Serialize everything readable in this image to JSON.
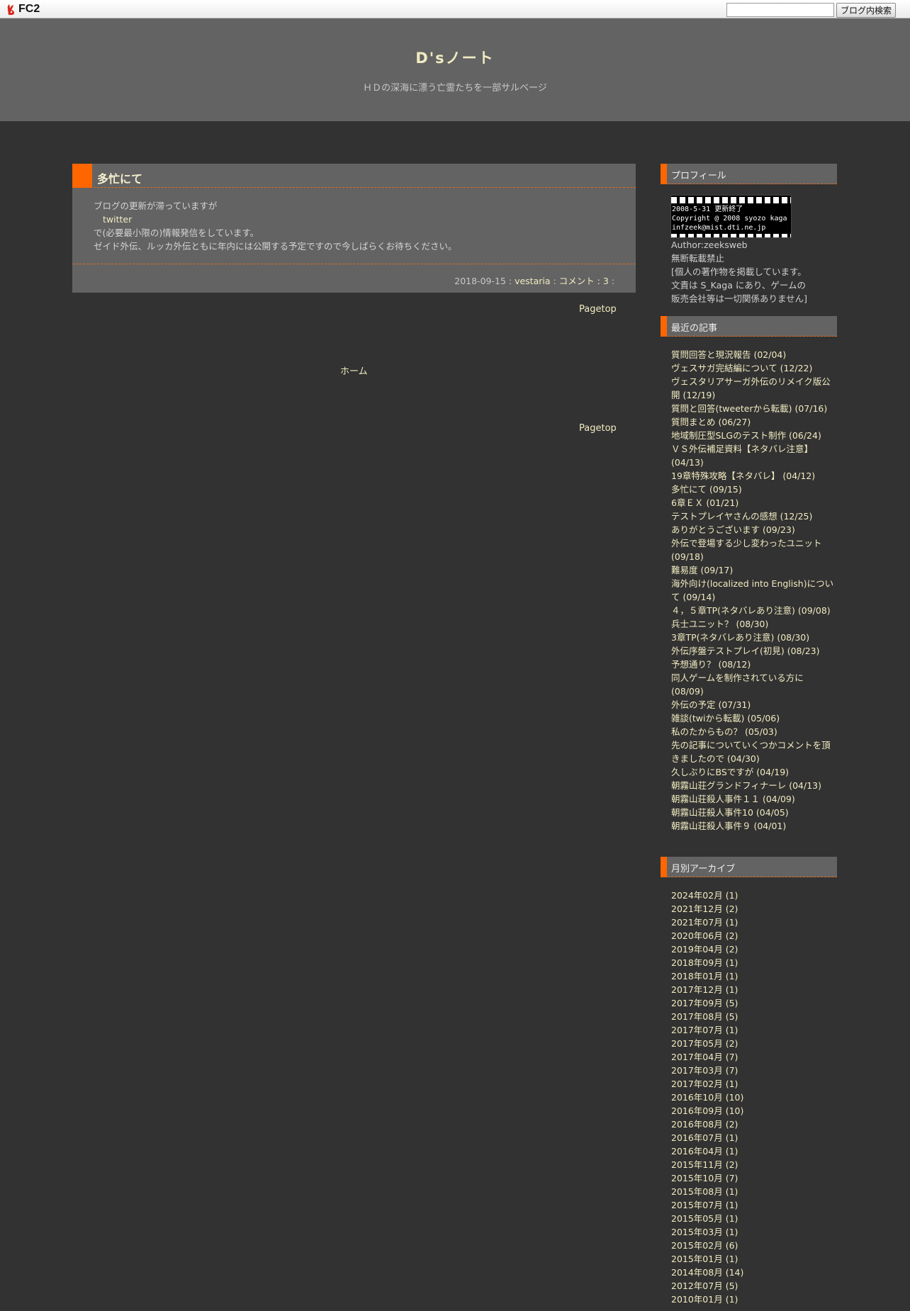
{
  "fc2bar": {
    "logo_text": "FC2",
    "search_value": "",
    "search_button": "ブログ内検索"
  },
  "header": {
    "title": "D'sノート",
    "description": "ＨＤの深海に漂う亡霊たちを一部サルベージ"
  },
  "entry": {
    "title": "多忙にて",
    "body_line1": "ブログの更新が滞っていますが",
    "body_link": "twitter",
    "body_line3": "で(必要最小限の)情報発信をしています。",
    "body_line4": "ゼイド外伝、ルッカ外伝ともに年内には公開する予定ですので今しばらくお待ちください。",
    "date": "2018-09-15",
    "sep1": " : ",
    "author": "vestaria",
    "sep2": " : ",
    "comments": "コメント : 3",
    "sep3": " :"
  },
  "nav": {
    "pagetop_top": "Pagetop",
    "home": "ホーム",
    "pagetop_bottom": "Pagetop"
  },
  "sidebar": {
    "profile": {
      "heading": "プロフィール",
      "image_lines": [
        "2008-5-31 更新終了",
        "Copyright @ 2008 syozo kaga",
        "infzeek@mist.dti.ne.jp"
      ],
      "lines": [
        "Author:zeeksweb",
        "無断転載禁止",
        "[個人の著作物を掲載しています。",
        "文責は S_Kaga にあり、ゲームの",
        "販売会社等は一切関係ありません]"
      ]
    },
    "recent": {
      "heading": "最近の記事",
      "items": [
        "質問回答と現況報告 (02/04)",
        "ヴェスサガ完結編について (12/22)",
        "ヴェスタリアサーガ外伝のリメイク版公開 (12/19)",
        "質問と回答(tweeterから転載) (07/16)",
        "質問まとめ (06/27)",
        "地域制圧型SLGのテスト制作 (06/24)",
        "ＶＳ外伝補足資料【ネタバレ注意】 (04/13)",
        "19章特殊攻略【ネタバレ】 (04/12)",
        "多忙にて (09/15)",
        "6章ＥＸ (01/21)",
        "テストプレイヤさんの感想 (12/25)",
        "ありがとうございます (09/23)",
        "外伝で登場する少し変わったユニット (09/18)",
        "難易度 (09/17)",
        "海外向け(localized into English)について (09/14)",
        "４，５章TP(ネタバレあり注意) (09/08)",
        "兵士ユニット？ (08/30)",
        "3章TP(ネタバレあり注意) (08/30)",
        "外伝序盤テストプレイ(初見) (08/23)",
        "予想通り？ (08/12)",
        "同人ゲームを制作されている方に (08/09)",
        "外伝の予定 (07/31)",
        "雑談(twiから転載) (05/06)",
        "私のたからもの？ (05/03)",
        "先の記事についていくつかコメントを頂きましたので (04/30)",
        "久しぶりにBSですが (04/19)",
        "朝霧山荘グランドフィナーレ (04/13)",
        "朝霧山荘殺人事件１１ (04/09)",
        "朝霧山荘殺人事件10 (04/05)",
        "朝霧山荘殺人事件９ (04/01)"
      ]
    },
    "archive": {
      "heading": "月別アーカイブ",
      "items": [
        "2024年02月 (1)",
        "2021年12月 (2)",
        "2021年07月 (1)",
        "2020年06月 (2)",
        "2019年04月 (2)",
        "2018年09月 (1)",
        "2018年01月 (1)",
        "2017年12月 (1)",
        "2017年09月 (5)",
        "2017年08月 (5)",
        "2017年07月 (1)",
        "2017年05月 (2)",
        "2017年04月 (7)",
        "2017年03月 (7)",
        "2017年02月 (1)",
        "2016年10月 (10)",
        "2016年09月 (10)",
        "2016年08月 (2)",
        "2016年07月 (1)",
        "2016年04月 (1)",
        "2015年11月 (2)",
        "2015年10月 (7)",
        "2015年08月 (1)",
        "2015年07月 (1)",
        "2015年05月 (1)",
        "2015年03月 (1)",
        "2015年02月 (6)",
        "2015年01月 (1)",
        "2014年08月 (14)",
        "2012年07月 (5)",
        "2010年01月 (1)"
      ]
    }
  }
}
